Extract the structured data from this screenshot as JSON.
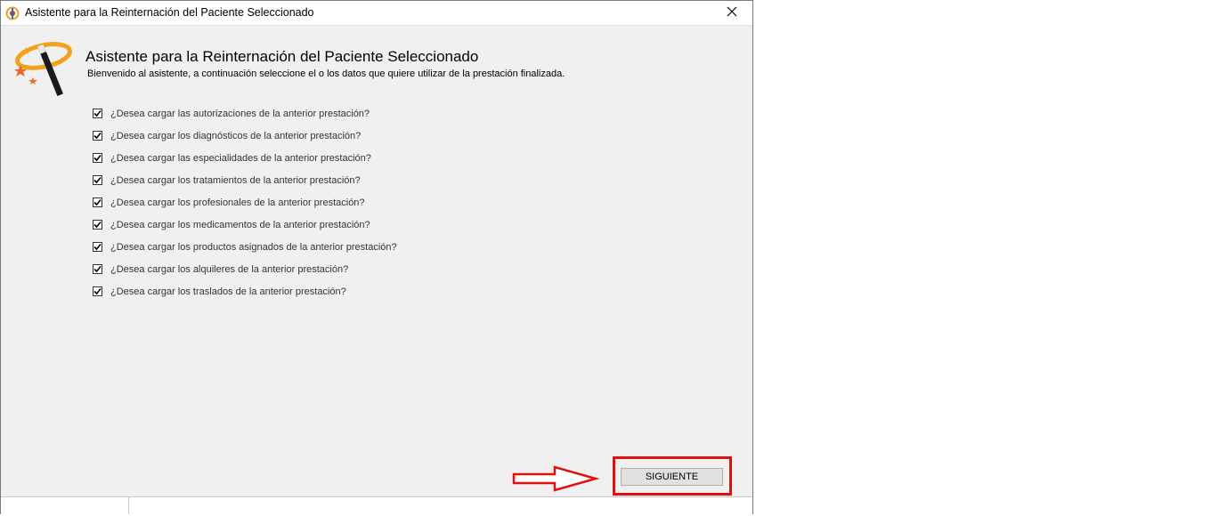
{
  "window": {
    "title": "Asistente para la Reinternación del Paciente Seleccionado",
    "app_icon": "app-logo-icon",
    "close_icon": "close-icon"
  },
  "header": {
    "icon": "magic-wand-icon",
    "title": "Asistente para la Reinternación del Paciente Seleccionado",
    "subtitle": "Bienvenido al asistente, a continuación seleccione el o los datos que quiere utilizar de la prestación finalizada."
  },
  "options": [
    {
      "label": "¿Desea cargar las autorizaciones de la anterior prestación?",
      "checked": true
    },
    {
      "label": "¿Desea cargar los diagnósticos de la anterior prestación?",
      "checked": true
    },
    {
      "label": "¿Desea cargar las especialidades de la anterior prestación?",
      "checked": true
    },
    {
      "label": "¿Desea cargar los tratamientos de la anterior prestación?",
      "checked": true
    },
    {
      "label": "¿Desea cargar los profesionales de la anterior prestación?",
      "checked": true
    },
    {
      "label": "¿Desea cargar los medicamentos de la anterior prestación?",
      "checked": true
    },
    {
      "label": "¿Desea cargar los productos asignados de la anterior prestación?",
      "checked": true
    },
    {
      "label": "¿Desea cargar los alquileres de la anterior prestación?",
      "checked": true
    },
    {
      "label": "¿Desea cargar los traslados de la anterior prestación?",
      "checked": true
    }
  ],
  "footer": {
    "next_label": "SIGUIENTE"
  },
  "annotation": {
    "color": "#e01010",
    "arrow_icon": "right-arrow-icon"
  }
}
